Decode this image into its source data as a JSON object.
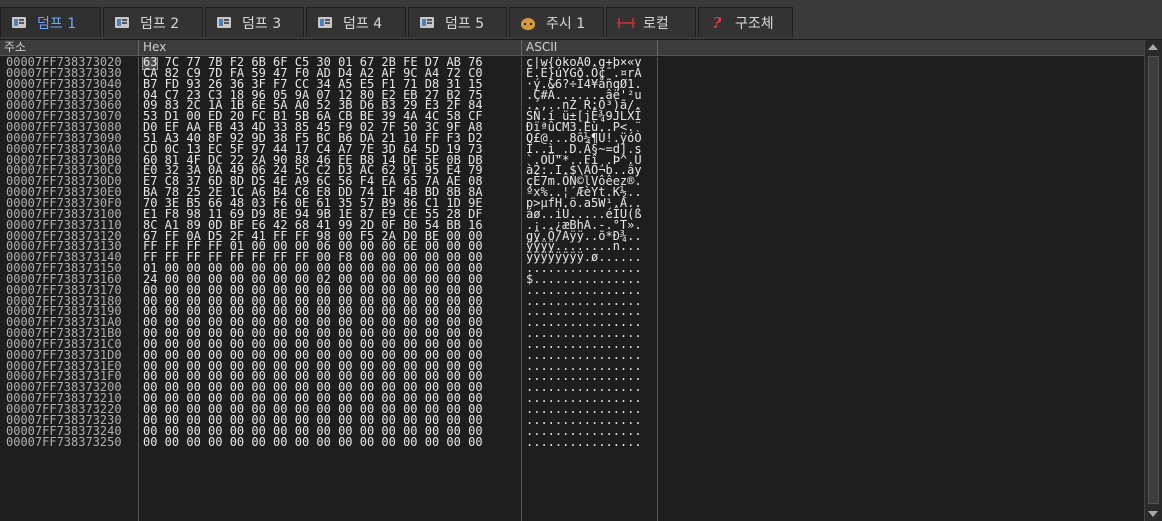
{
  "tabs": [
    {
      "label": "덤프 1",
      "icon": "dump-icon",
      "active": true
    },
    {
      "label": "덤프 2",
      "icon": "dump-icon"
    },
    {
      "label": "덤프 3",
      "icon": "dump-icon"
    },
    {
      "label": "덤프 4",
      "icon": "dump-icon"
    },
    {
      "label": "덤프 5",
      "icon": "dump-icon"
    },
    {
      "label": "주시 1",
      "icon": "watch-icon"
    },
    {
      "label": "로컬",
      "icon": "locals-icon"
    },
    {
      "label": "구조체",
      "icon": "struct-icon"
    }
  ],
  "columns": {
    "address": "주소",
    "hex": "Hex",
    "ascii": "ASCII"
  },
  "struct_glyph": "?",
  "rows": [
    {
      "addr": "00007FF738373020",
      "hex": "63 7C 77 7B F2 6B 6F C5 30 01 67 2B FE D7 AB 76",
      "ascii": "c|w{òkoÅ0.g+þ×«v"
    },
    {
      "addr": "00007FF738373030",
      "hex": "CA 82 C9 7D FA 59 47 F0 AD D4 A2 AF 9C A4 72 C0",
      "ascii": "Ê.É}úYGð.Ô¢¯.¤rÀ"
    },
    {
      "addr": "00007FF738373040",
      "hex": "B7 FD 93 26 36 3F F7 CC 34 A5 E5 F1 71 D8 31 15",
      "ascii": "·ý.&6?÷Ì4¥åñqØ1."
    },
    {
      "addr": "00007FF738373050",
      "hex": "04 C7 23 C3 18 96 05 9A 07 12 80 E2 EB 27 B2 75",
      "ascii": ".Ç#Ã.......âë'²u"
    },
    {
      "addr": "00007FF738373060",
      "hex": "09 83 2C 1A 1B 6E 5A A0 52 3B D6 B3 29 E3 2F 84",
      "ascii": "..,..nZ R;Ö³)ã/."
    },
    {
      "addr": "00007FF738373070",
      "hex": "53 D1 00 ED 20 FC B1 5B 6A CB BE 39 4A 4C 58 CF",
      "ascii": "SÑ.í ü±[jË¾9JLXÏ"
    },
    {
      "addr": "00007FF738373080",
      "hex": "D0 EF AA FB 43 4D 33 85 45 F9 02 7F 50 3C 9F A8",
      "ascii": "ÐïªûCM3.Eù..P<.¨"
    },
    {
      "addr": "00007FF738373090",
      "hex": "51 A3 40 8F 92 9D 38 F5 BC B6 DA 21 10 FF F3 D2",
      "ascii": "Q£@...8õ¼¶Ú!.ÿóÒ"
    },
    {
      "addr": "00007FF7383730A0",
      "hex": "CD 0C 13 EC 5F 97 44 17 C4 A7 7E 3D 64 5D 19 73",
      "ascii": "Í..ì_.D.Ä§~=d].s"
    },
    {
      "addr": "00007FF7383730B0",
      "hex": "60 81 4F DC 22 2A 90 88 46 EE B8 14 DE 5E 0B DB",
      "ascii": "`.OÜ\"*..Fî¸.Þ^.Û"
    },
    {
      "addr": "00007FF7383730C0",
      "hex": "E0 32 3A 0A 49 06 24 5C C2 D3 AC 62 91 95 E4 79",
      "ascii": "à2:.I.$\\ÂÓ¬b..äy"
    },
    {
      "addr": "00007FF7383730D0",
      "hex": "E7 C8 37 6D 8D D5 4E A9 6C 56 F4 EA 65 7A AE 08",
      "ascii": "çÈ7m.ÕN©lVôêez®."
    },
    {
      "addr": "00007FF7383730E0",
      "hex": "BA 78 25 2E 1C A6 B4 C6 E8 DD 74 1F 4B BD 8B 8A",
      "ascii": "ºx%..¦´ÆèÝt.K½.."
    },
    {
      "addr": "00007FF7383730F0",
      "hex": "70 3E B5 66 48 03 F6 0E 61 35 57 B9 86 C1 1D 9E",
      "ascii": "p>µfH.ö.a5W¹.Á.."
    },
    {
      "addr": "00007FF738373100",
      "hex": "E1 F8 98 11 69 D9 8E 94 9B 1E 87 E9 CE 55 28 DF",
      "ascii": "áø..iÙ.....éÎU(ß"
    },
    {
      "addr": "00007FF738373110",
      "hex": "8C A1 89 0D BF E6 42 68 41 99 2D 0F B0 54 BB 16",
      "ascii": ".¡..¿æBhA.-.°T»."
    },
    {
      "addr": "00007FF738373120",
      "hex": "67 FF 0A D5 2F 41 FF FF 98 00 F5 2A D0 BE 00 00",
      "ascii": "gÿ.Õ/Aÿÿ..õ*Ð¾.."
    },
    {
      "addr": "00007FF738373130",
      "hex": "FF FF FF FF 01 00 00 00 06 00 00 00 6E 00 00 00",
      "ascii": "ÿÿÿÿ........n..."
    },
    {
      "addr": "00007FF738373140",
      "hex": "FF FF FF FF FF FF FF FF 00 F8 00 00 00 00 00 00",
      "ascii": "ÿÿÿÿÿÿÿÿ.ø......"
    },
    {
      "addr": "00007FF738373150",
      "hex": "01 00 00 00 00 00 00 00 00 00 00 00 00 00 00 00",
      "ascii": "................"
    },
    {
      "addr": "00007FF738373160",
      "hex": "24 00 00 00 00 00 00 00 02 00 00 00 00 00 00 00",
      "ascii": "$..............."
    },
    {
      "addr": "00007FF738373170",
      "hex": "00 00 00 00 00 00 00 00 00 00 00 00 00 00 00 00",
      "ascii": "................"
    },
    {
      "addr": "00007FF738373180",
      "hex": "00 00 00 00 00 00 00 00 00 00 00 00 00 00 00 00",
      "ascii": "................"
    },
    {
      "addr": "00007FF738373190",
      "hex": "00 00 00 00 00 00 00 00 00 00 00 00 00 00 00 00",
      "ascii": "................"
    },
    {
      "addr": "00007FF7383731A0",
      "hex": "00 00 00 00 00 00 00 00 00 00 00 00 00 00 00 00",
      "ascii": "................"
    },
    {
      "addr": "00007FF7383731B0",
      "hex": "00 00 00 00 00 00 00 00 00 00 00 00 00 00 00 00",
      "ascii": "................"
    },
    {
      "addr": "00007FF7383731C0",
      "hex": "00 00 00 00 00 00 00 00 00 00 00 00 00 00 00 00",
      "ascii": "................"
    },
    {
      "addr": "00007FF7383731D0",
      "hex": "00 00 00 00 00 00 00 00 00 00 00 00 00 00 00 00",
      "ascii": "................"
    },
    {
      "addr": "00007FF7383731E0",
      "hex": "00 00 00 00 00 00 00 00 00 00 00 00 00 00 00 00",
      "ascii": "................"
    },
    {
      "addr": "00007FF7383731F0",
      "hex": "00 00 00 00 00 00 00 00 00 00 00 00 00 00 00 00",
      "ascii": "................"
    },
    {
      "addr": "00007FF738373200",
      "hex": "00 00 00 00 00 00 00 00 00 00 00 00 00 00 00 00",
      "ascii": "................"
    },
    {
      "addr": "00007FF738373210",
      "hex": "00 00 00 00 00 00 00 00 00 00 00 00 00 00 00 00",
      "ascii": "................"
    },
    {
      "addr": "00007FF738373220",
      "hex": "00 00 00 00 00 00 00 00 00 00 00 00 00 00 00 00",
      "ascii": "................"
    },
    {
      "addr": "00007FF738373230",
      "hex": "00 00 00 00 00 00 00 00 00 00 00 00 00 00 00 00",
      "ascii": "................"
    },
    {
      "addr": "00007FF738373240",
      "hex": "00 00 00 00 00 00 00 00 00 00 00 00 00 00 00 00",
      "ascii": "................"
    },
    {
      "addr": "00007FF738373250",
      "hex": "00 00 00 00 00 00 00 00 00 00 00 00 00 00 00 00",
      "ascii": "................"
    }
  ]
}
